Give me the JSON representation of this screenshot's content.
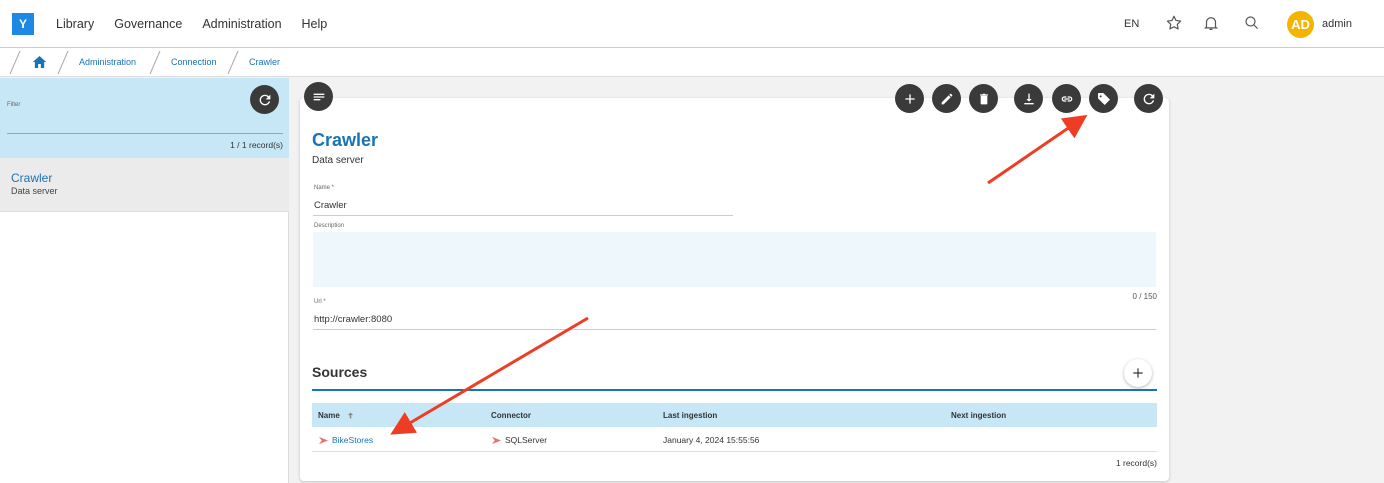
{
  "app": {
    "logo_letter": "Y",
    "nav": [
      "Library",
      "Governance",
      "Administration",
      "Help"
    ],
    "language": "EN",
    "user_initials": "AD",
    "username": "admin",
    "avatar_color": "#f4b400"
  },
  "breadcrumb": [
    "Administration",
    "Connection",
    "Crawler"
  ],
  "left_panel": {
    "filter_label": "Filter",
    "records": "1 / 1 record(s)",
    "items": [
      {
        "title": "Crawler",
        "subtitle": "Data server"
      }
    ]
  },
  "detail": {
    "title": "Crawler",
    "subtitle": "Data server",
    "name_label": "Name *",
    "name_value": "Crawler",
    "description_label": "Description",
    "description_value": "",
    "char_count": "0 / 150",
    "url_label": "Url *",
    "url_value": "http://crawler:8080",
    "toolbar_icons": [
      "add-icon",
      "edit-icon",
      "delete-icon",
      "download-icon",
      "link-icon",
      "tag-icon",
      "refresh-icon"
    ]
  },
  "sources": {
    "title": "Sources",
    "columns": [
      "Name",
      "Connector",
      "Last ingestion",
      "Next ingestion"
    ],
    "rows": [
      {
        "name": "BikeStores",
        "connector": "SQLServer",
        "last_ingestion": "January 4, 2024 15:55:56",
        "next_ingestion": ""
      }
    ],
    "row_count": "1 record(s)"
  },
  "colors": {
    "accent": "#1a73b5",
    "header_band": "#c7e7f7",
    "annotation_arrow": "#ee3d24"
  }
}
